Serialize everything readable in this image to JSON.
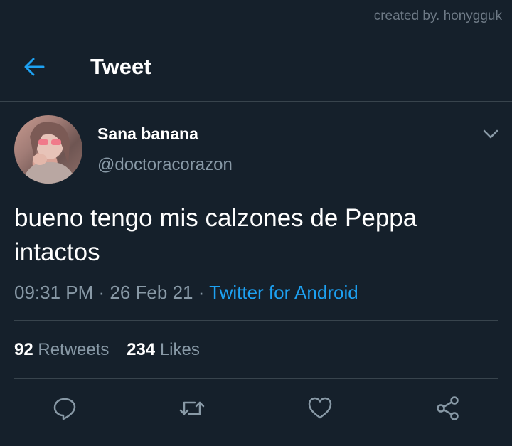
{
  "watermark": "created by. honygguk",
  "header": {
    "title": "Tweet",
    "back_icon": "arrow-left-icon",
    "accent": "#1da1f2"
  },
  "author": {
    "display_name": "Sana banana",
    "handle": "@doctoracorazon"
  },
  "tweet": {
    "text": "bueno tengo mis calzones de Peppa intactos",
    "time": "09:31 PM",
    "date": "26 Feb 21",
    "source": "Twitter for Android",
    "separator": " · "
  },
  "stats": {
    "retweets_count": "92",
    "retweets_label": "Retweets",
    "likes_count": "234",
    "likes_label": "Likes"
  },
  "actions": [
    "reply-icon",
    "retweet-icon",
    "like-icon",
    "share-icon"
  ],
  "colors": {
    "background": "#15202b",
    "border": "#38444d",
    "muted": "#8899a6",
    "link": "#1da1f2"
  }
}
